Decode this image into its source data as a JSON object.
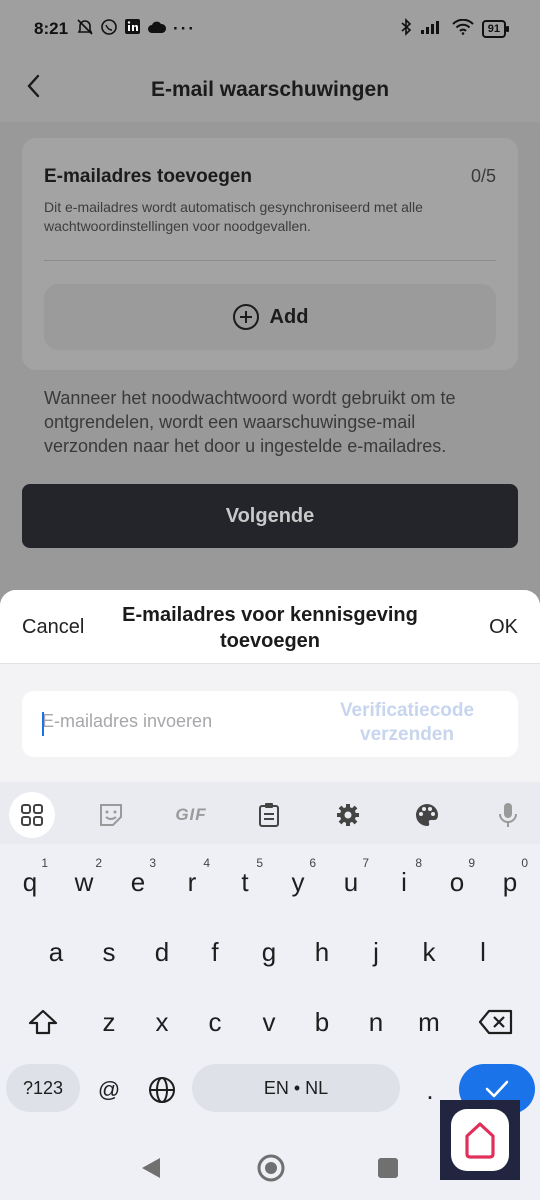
{
  "status_bar": {
    "time": "8:21",
    "battery": "91"
  },
  "header": {
    "title": "E-mail waarschuwingen"
  },
  "card": {
    "title": "E-mailadres toevoegen",
    "count": "0/5",
    "description": "Dit e-mailadres wordt automatisch gesynchroniseerd met alle wachtwoordinstellingen voor noodgevallen.",
    "add_label": "Add"
  },
  "info_text": "Wanneer het noodwachtwoord wordt gebruikt om te ontgrendelen, wordt een waarschuwingse-mail verzonden naar het door u ingestelde e-mailadres.",
  "next_button": "Volgende",
  "sheet": {
    "cancel": "Cancel",
    "title": "E-mailadres voor kennisgeving toevoegen",
    "ok": "OK",
    "email_value": "",
    "email_placeholder": "E-mailadres invoeren",
    "verify_button": "Verificatiecode verzenden"
  },
  "keyboard": {
    "row1": [
      {
        "key": "q",
        "hint": "1"
      },
      {
        "key": "w",
        "hint": "2"
      },
      {
        "key": "e",
        "hint": "3"
      },
      {
        "key": "r",
        "hint": "4"
      },
      {
        "key": "t",
        "hint": "5"
      },
      {
        "key": "y",
        "hint": "6"
      },
      {
        "key": "u",
        "hint": "7"
      },
      {
        "key": "i",
        "hint": "8"
      },
      {
        "key": "o",
        "hint": "9"
      },
      {
        "key": "p",
        "hint": "0"
      }
    ],
    "row2": [
      "a",
      "s",
      "d",
      "f",
      "g",
      "h",
      "j",
      "k",
      "l"
    ],
    "row3": [
      "z",
      "x",
      "c",
      "v",
      "b",
      "n",
      "m"
    ],
    "symbols_key": "?123",
    "at_key": "@",
    "space_label": "EN • NL",
    "period_key": ".",
    "toolbar_gif": "GIF"
  },
  "colors": {
    "accent": "#1a73e8",
    "primary_button": "#23252b"
  }
}
